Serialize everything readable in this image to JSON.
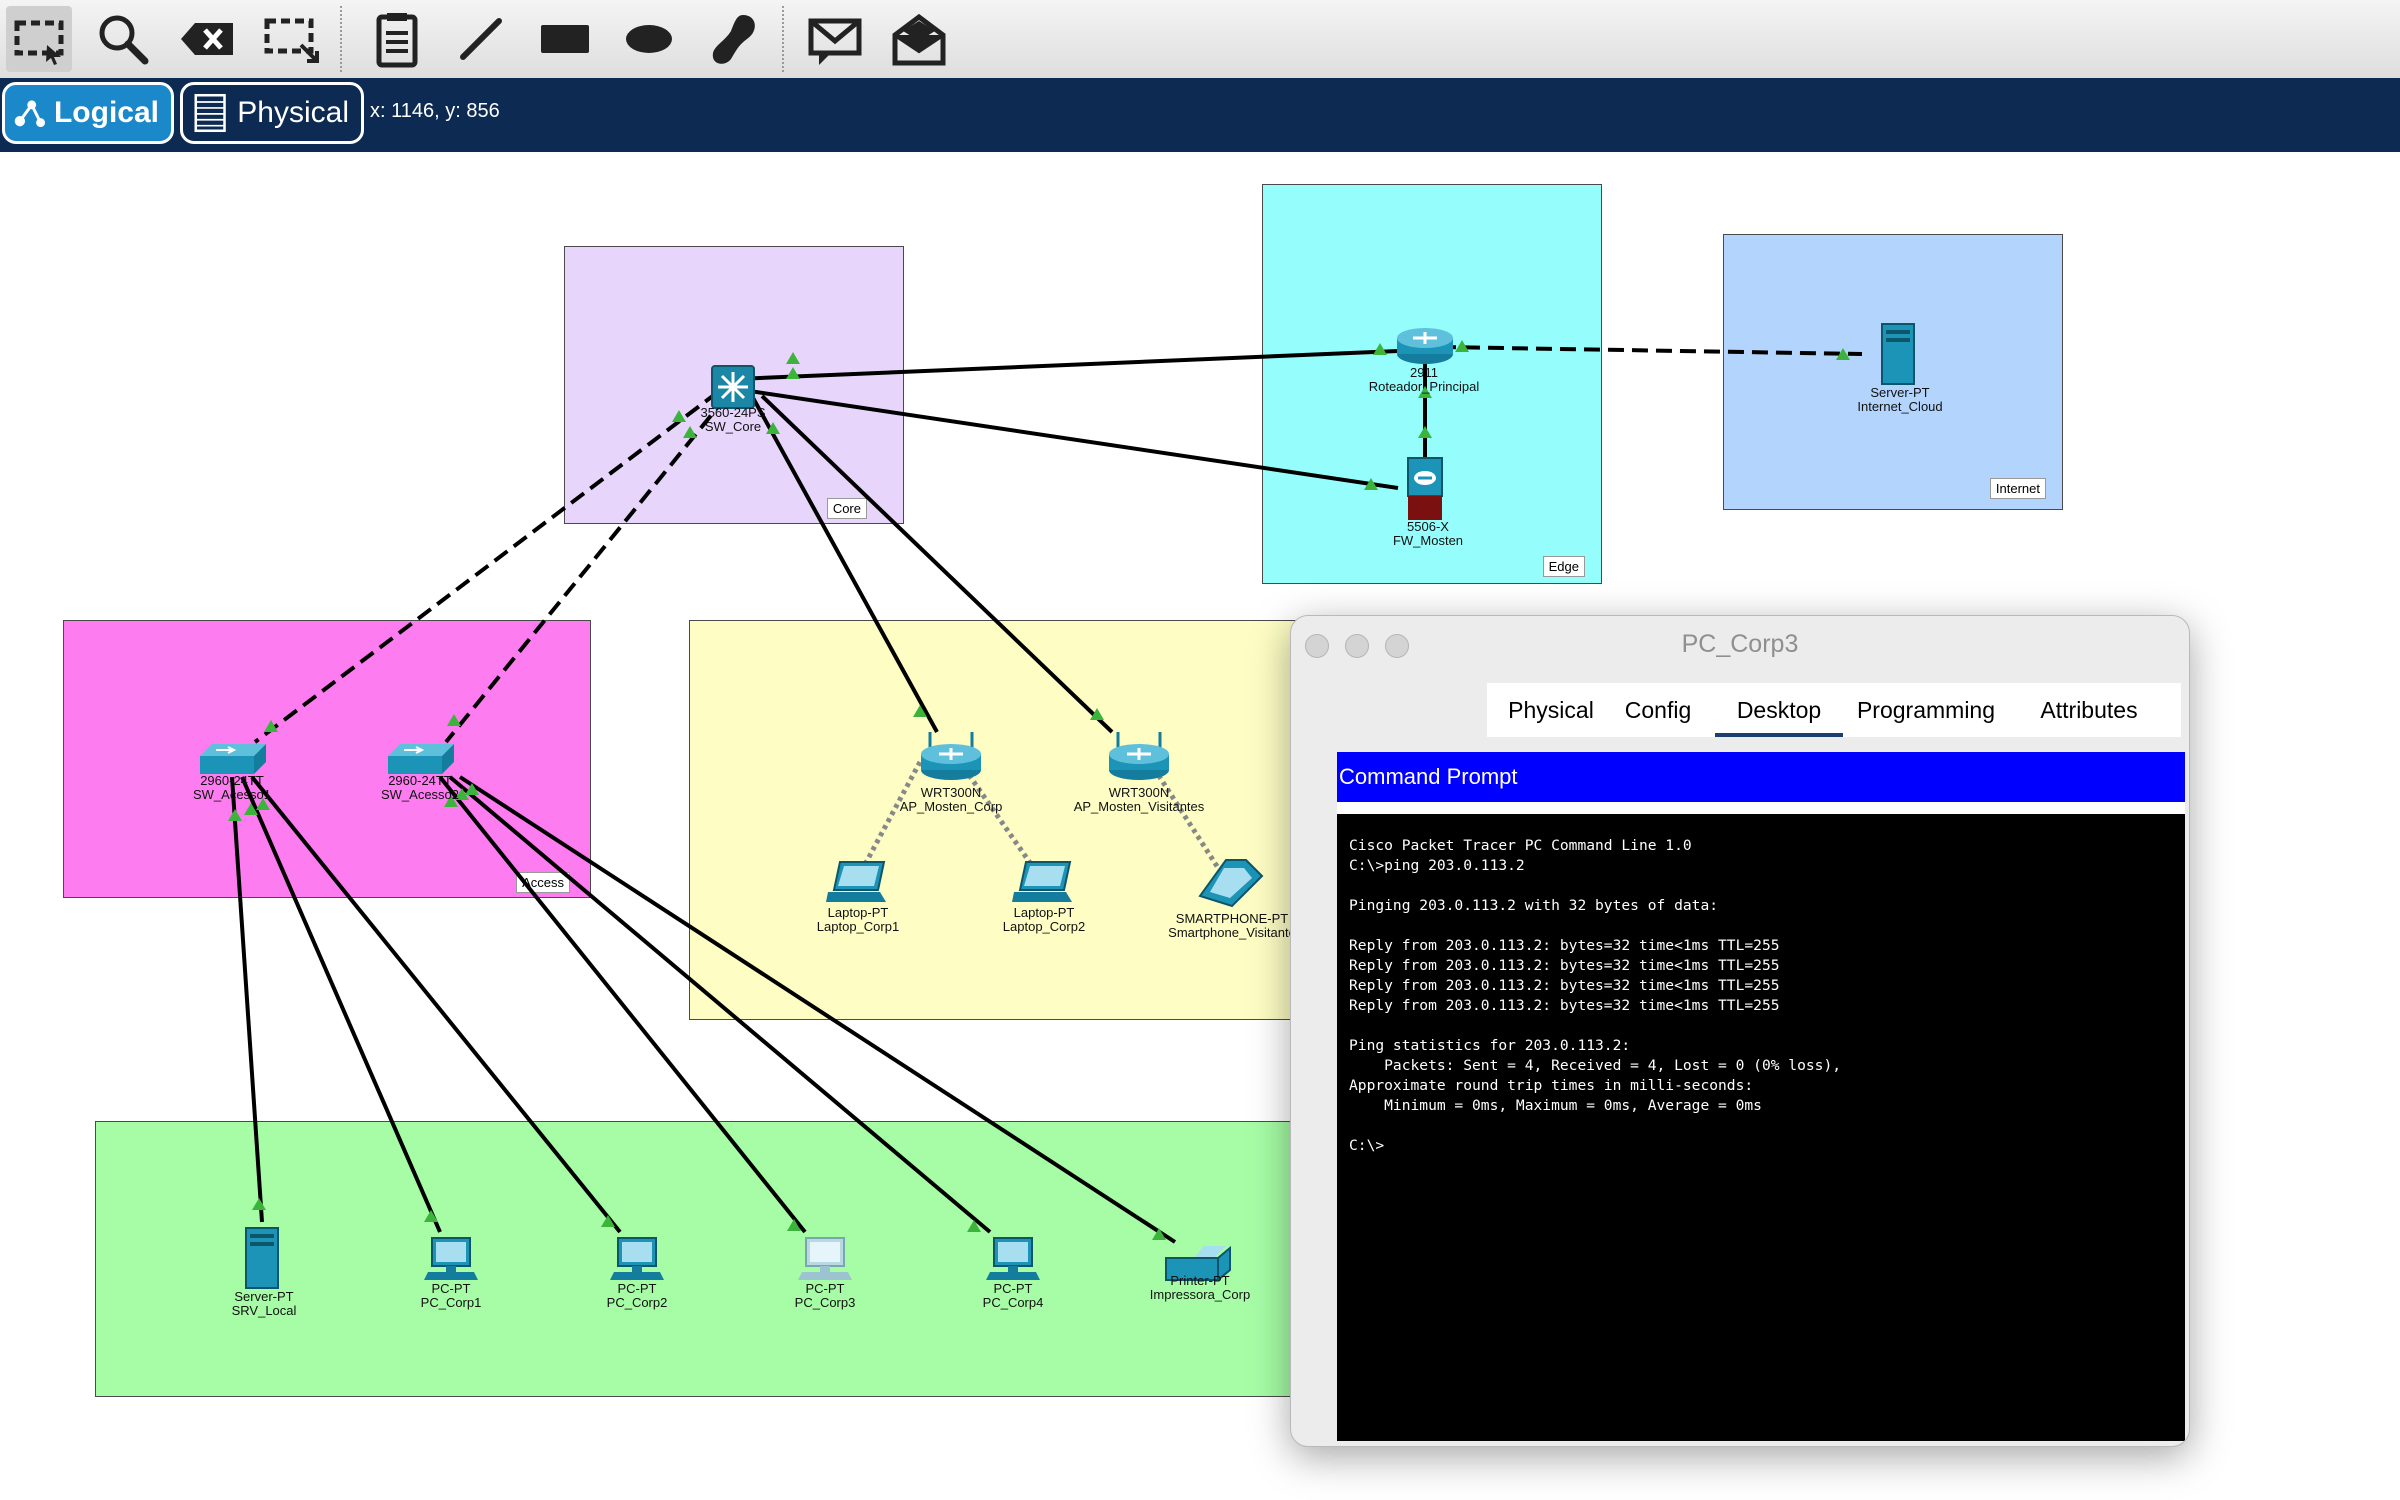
{
  "toolbar": {
    "tools": [
      {
        "icon": "select-icon"
      },
      {
        "icon": "zoom-icon"
      },
      {
        "icon": "delete-icon"
      },
      {
        "icon": "resize-icon"
      },
      {
        "icon": "note-icon"
      },
      {
        "icon": "line-icon"
      },
      {
        "icon": "rectangle-icon"
      },
      {
        "icon": "ellipse-icon"
      },
      {
        "icon": "freeform-icon"
      },
      {
        "icon": "simple-pdu-icon"
      },
      {
        "icon": "complex-pdu-icon"
      }
    ]
  },
  "modebar": {
    "logical_label": "Logical",
    "physical_label": "Physical",
    "coordinates": "x: 1146, y: 856"
  },
  "areas": {
    "core": "Core",
    "edge": "Edge",
    "internet": "Internet",
    "access": "Access"
  },
  "devices": {
    "sw_core": {
      "model": "3560-24PS",
      "name": "SW_Core"
    },
    "router": {
      "model": "2911",
      "name": "Roteador_Principal"
    },
    "firewall": {
      "model": "5506-X",
      "name": "FW_Mosten"
    },
    "internet_server": {
      "model": "Server-PT",
      "name": "Internet_Cloud"
    },
    "sw_acesso1": {
      "model": "2960-24TT",
      "name": "SW_Acesso1"
    },
    "sw_acesso2": {
      "model": "2960-24TT",
      "name": "SW_Acesso2"
    },
    "ap_corp": {
      "model": "WRT300N",
      "name": "AP_Mosten_Corp"
    },
    "ap_visitantes": {
      "model": "WRT300N",
      "name": "AP_Mosten_Visitantes"
    },
    "laptop1": {
      "model": "Laptop-PT",
      "name": "Laptop_Corp1"
    },
    "laptop2": {
      "model": "Laptop-PT",
      "name": "Laptop_Corp2"
    },
    "smartphone": {
      "model": "SMARTPHONE-PT",
      "name": "Smartphone_Visitante"
    },
    "srv_local": {
      "model": "Server-PT",
      "name": "SRV_Local"
    },
    "pc1": {
      "model": "PC-PT",
      "name": "PC_Corp1"
    },
    "pc2": {
      "model": "PC-PT",
      "name": "PC_Corp2"
    },
    "pc3": {
      "model": "PC-PT",
      "name": "PC_Corp3"
    },
    "pc4": {
      "model": "PC-PT",
      "name": "PC_Corp4"
    },
    "printer": {
      "model": "Printer-PT",
      "name": "Impressora_Corp"
    }
  },
  "colors": {
    "core_area": "#e8d5fc",
    "edge_area": "#96fdfd",
    "internet_area": "#b2d4fd",
    "access_area": "#fd7cf0",
    "wireless_area": "#fdfdc4",
    "endpoint_area": "#a6fda6",
    "link_up": "#3cb43c",
    "cmd_header": "#0000ff",
    "modebar": "#0d2a52"
  },
  "pc_window": {
    "title": "PC_Corp3",
    "tabs": [
      "Physical",
      "Config",
      "Desktop",
      "Programming",
      "Attributes"
    ],
    "active_tab": "Desktop",
    "app_title": "Command Prompt",
    "terminal_lines": [
      "Cisco Packet Tracer PC Command Line 1.0",
      "C:\\>ping 203.0.113.2",
      "",
      "Pinging 203.0.113.2 with 32 bytes of data:",
      "",
      "Reply from 203.0.113.2: bytes=32 time<1ms TTL=255",
      "Reply from 203.0.113.2: bytes=32 time<1ms TTL=255",
      "Reply from 203.0.113.2: bytes=32 time<1ms TTL=255",
      "Reply from 203.0.113.2: bytes=32 time<1ms TTL=255",
      "",
      "Ping statistics for 203.0.113.2:",
      "    Packets: Sent = 4, Received = 4, Lost = 0 (0% loss),",
      "Approximate round trip times in milli-seconds:",
      "    Minimum = 0ms, Maximum = 0ms, Average = 0ms",
      "",
      "C:\\>"
    ]
  }
}
